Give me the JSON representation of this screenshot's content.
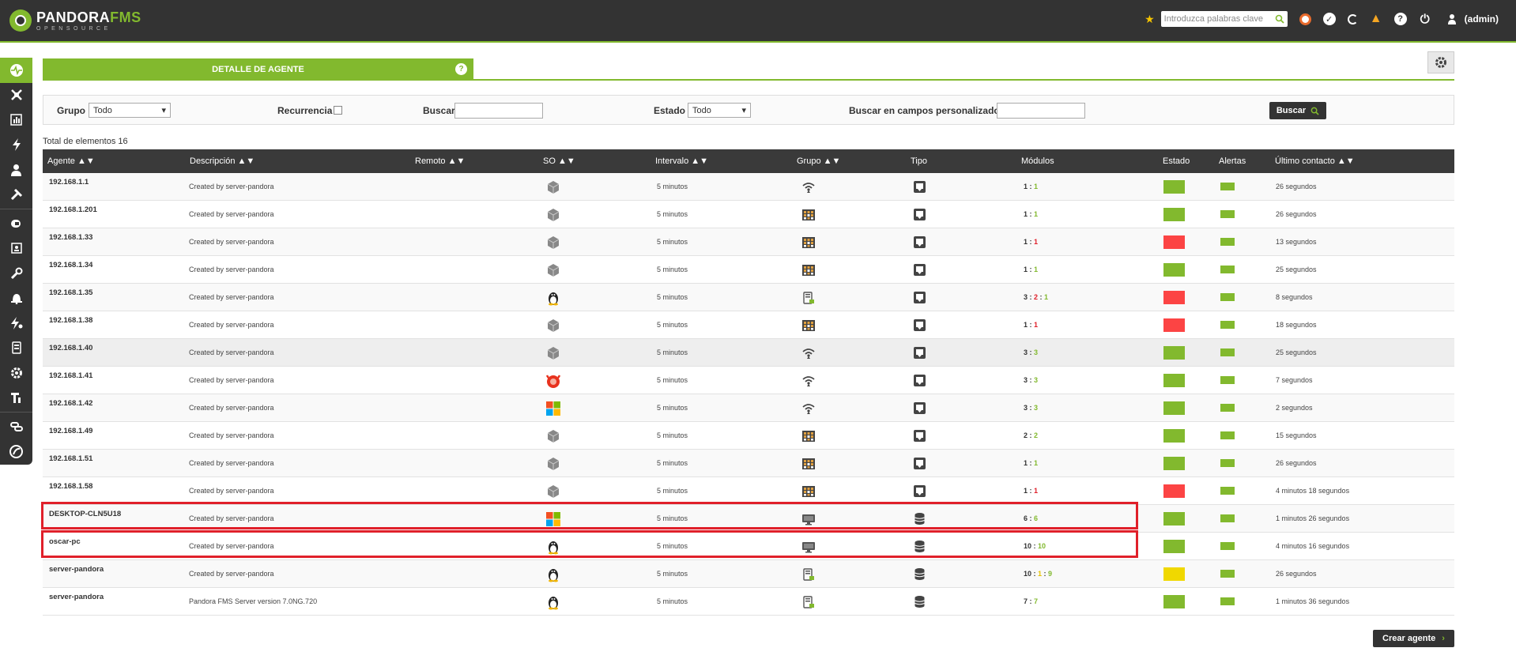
{
  "header": {
    "logo_main_a": "PANDORA",
    "logo_main_b": "FMS",
    "logo_sub": "OPENSOURCE",
    "search_placeholder": "Introduzca palabras clave",
    "user": "(admin)"
  },
  "tab": {
    "label": "DETALLE DE AGENTE",
    "help": "?"
  },
  "filter": {
    "grupo_label": "Grupo",
    "grupo_value": "Todo",
    "recurrencia_label": "Recurrencia",
    "buscar_label": "Buscar",
    "estado_label": "Estado",
    "estado_value": "Todo",
    "custom_label": "Buscar en campos personalizados",
    "button": "Buscar"
  },
  "total": "Total de elementos 16",
  "columns": {
    "agente": "Agente",
    "descripcion": "Descripción",
    "remoto": "Remoto",
    "so": "SO",
    "intervalo": "Intervalo",
    "grupo": "Grupo",
    "tipo": "Tipo",
    "modulos": "Módulos",
    "estado": "Estado",
    "alertas": "Alertas",
    "contacto": "Último contacto"
  },
  "rows": [
    {
      "agent": "192.168.1.1",
      "desc": "Created by server-pandora",
      "interval": "5 minutos",
      "os": "generic",
      "group": "wifi",
      "type": "monitor",
      "m": [
        [
          "1",
          "#333"
        ],
        [
          "1",
          "#82b92e"
        ]
      ],
      "status": "#82b92e",
      "contact": "26 segundos"
    },
    {
      "agent": "192.168.1.201",
      "desc": "Created by server-pandora",
      "interval": "5 minutos",
      "os": "generic",
      "group": "grid",
      "type": "monitor",
      "m": [
        [
          "1",
          "#333"
        ],
        [
          "1",
          "#82b92e"
        ]
      ],
      "status": "#82b92e",
      "contact": "26 segundos"
    },
    {
      "agent": "192.168.1.33",
      "desc": "Created by server-pandora",
      "interval": "5 minutos",
      "os": "generic",
      "group": "grid",
      "type": "monitor",
      "m": [
        [
          "1",
          "#333"
        ],
        [
          "1",
          "#e0202a"
        ]
      ],
      "status": "#fc4444",
      "contact": "13 segundos"
    },
    {
      "agent": "192.168.1.34",
      "desc": "Created by server-pandora",
      "interval": "5 minutos",
      "os": "generic",
      "group": "grid",
      "type": "monitor",
      "m": [
        [
          "1",
          "#333"
        ],
        [
          "1",
          "#82b92e"
        ]
      ],
      "status": "#82b92e",
      "contact": "25 segundos"
    },
    {
      "agent": "192.168.1.35",
      "desc": "Created by server-pandora",
      "interval": "5 minutos",
      "os": "linux",
      "group": "server",
      "type": "monitor",
      "m": [
        [
          "3",
          "#333"
        ],
        [
          "2",
          "#e0202a"
        ],
        [
          "1",
          "#82b92e"
        ]
      ],
      "status": "#fc4444",
      "contact": "8 segundos"
    },
    {
      "agent": "192.168.1.38",
      "desc": "Created by server-pandora",
      "interval": "5 minutos",
      "os": "generic",
      "group": "grid",
      "type": "monitor",
      "m": [
        [
          "1",
          "#333"
        ],
        [
          "1",
          "#e0202a"
        ]
      ],
      "status": "#fc4444",
      "contact": "18 segundos"
    },
    {
      "agent": "192.168.1.40",
      "desc": "Created by server-pandora",
      "interval": "5 minutos",
      "os": "generic",
      "group": "wifi",
      "type": "monitor",
      "m": [
        [
          "3",
          "#333"
        ],
        [
          "3",
          "#82b92e"
        ]
      ],
      "status": "#82b92e",
      "contact": "25 segundos"
    },
    {
      "agent": "192.168.1.41",
      "desc": "Created by server-pandora",
      "interval": "5 minutos",
      "os": "bsd",
      "group": "wifi",
      "type": "monitor",
      "m": [
        [
          "3",
          "#333"
        ],
        [
          "3",
          "#82b92e"
        ]
      ],
      "status": "#82b92e",
      "contact": "7 segundos"
    },
    {
      "agent": "192.168.1.42",
      "desc": "Created by server-pandora",
      "interval": "5 minutos",
      "os": "windows",
      "group": "wifi",
      "type": "monitor",
      "m": [
        [
          "3",
          "#333"
        ],
        [
          "3",
          "#82b92e"
        ]
      ],
      "status": "#82b92e",
      "contact": "2 segundos"
    },
    {
      "agent": "192.168.1.49",
      "desc": "Created by server-pandora",
      "interval": "5 minutos",
      "os": "generic",
      "group": "grid",
      "type": "monitor",
      "m": [
        [
          "2",
          "#333"
        ],
        [
          "2",
          "#82b92e"
        ]
      ],
      "status": "#82b92e",
      "contact": "15 segundos"
    },
    {
      "agent": "192.168.1.51",
      "desc": "Created by server-pandora",
      "interval": "5 minutos",
      "os": "generic",
      "group": "grid",
      "type": "monitor",
      "m": [
        [
          "1",
          "#333"
        ],
        [
          "1",
          "#82b92e"
        ]
      ],
      "status": "#82b92e",
      "contact": "26 segundos"
    },
    {
      "agent": "192.168.1.58",
      "desc": "Created by server-pandora",
      "interval": "5 minutos",
      "os": "generic",
      "group": "grid",
      "type": "monitor",
      "m": [
        [
          "1",
          "#333"
        ],
        [
          "1",
          "#e0202a"
        ]
      ],
      "status": "#fc4444",
      "contact": "4 minutos 18 segundos"
    },
    {
      "agent": "DESKTOP-CLN5U18",
      "desc": "Created by server-pandora",
      "interval": "5 minutos",
      "os": "windows",
      "group": "desktop",
      "type": "db",
      "m": [
        [
          "6",
          "#333"
        ],
        [
          "6",
          "#82b92e"
        ]
      ],
      "status": "#82b92e",
      "contact": "1 minutos 26 segundos"
    },
    {
      "agent": "oscar-pc",
      "desc": "Created by server-pandora",
      "interval": "5 minutos",
      "os": "linux",
      "group": "desktop",
      "type": "db",
      "m": [
        [
          "10",
          "#333"
        ],
        [
          "10",
          "#82b92e"
        ]
      ],
      "status": "#82b92e",
      "contact": "4 minutos 16 segundos"
    },
    {
      "agent": "server-pandora",
      "desc": "Created by server-pandora",
      "interval": "5 minutos",
      "os": "linux",
      "group": "server",
      "type": "db",
      "m": [
        [
          "10",
          "#333"
        ],
        [
          "1",
          "#e6c200"
        ],
        [
          "9",
          "#82b92e"
        ]
      ],
      "status": "#f0d800",
      "contact": "26 segundos"
    },
    {
      "agent": "server-pandora",
      "desc": "Pandora FMS Server version 7.0NG.720",
      "interval": "5 minutos",
      "os": "linux",
      "group": "server",
      "type": "db",
      "m": [
        [
          "7",
          "#333"
        ],
        [
          "7",
          "#82b92e"
        ]
      ],
      "status": "#82b92e",
      "contact": "1 minutos 36 segundos"
    }
  ],
  "create_button": "Crear agente",
  "colors": {
    "accent": "#82b92e",
    "dark": "#333333",
    "critical": "#fc4444",
    "warning": "#f0d800",
    "highlight": "#e0202a"
  }
}
